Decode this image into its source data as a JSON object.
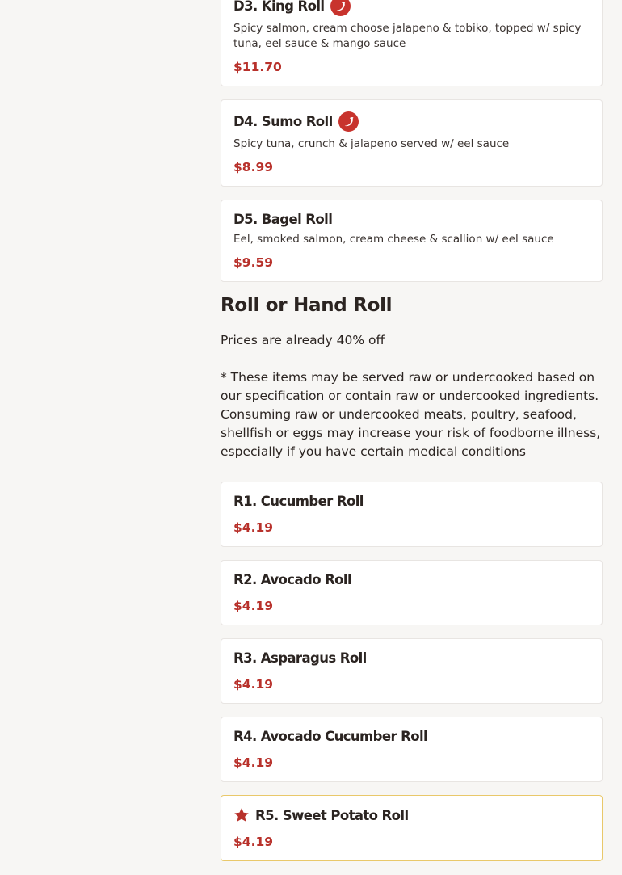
{
  "items_top": [
    {
      "title": "D3. King Roll",
      "spicy": true,
      "description": "Spicy salmon, cream choose jalapeno & tobiko, topped w/ spicy tuna, eel sauce & mango sauce",
      "price": "$11.70"
    },
    {
      "title": "D4. Sumo Roll",
      "spicy": true,
      "description": "Spicy tuna, crunch & jalapeno served w/ eel sauce",
      "price": "$8.99"
    },
    {
      "title": "D5. Bagel Roll",
      "spicy": false,
      "description": "Eel, smoked salmon, cream cheese & scallion w/ eel sauce",
      "price": "$9.59"
    }
  ],
  "section": {
    "title": "Roll or Hand Roll",
    "note_line1": "Prices are already 40% off",
    "note_line2": "* These items may be served raw or undercooked based on our specification or contain raw or undercooked ingredients. Consuming raw or undercooked meats, poultry, seafood, shellfish or eggs may increase your risk of foodborne illness, especially if you have certain medical conditions"
  },
  "items_rolls": [
    {
      "title": "R1. Cucumber Roll",
      "price": "$4.19"
    },
    {
      "title": "R2. Avocado Roll",
      "price": "$4.19"
    },
    {
      "title": "R3. Asparagus Roll",
      "price": "$4.19"
    },
    {
      "title": "R4. Avocado Cucumber Roll",
      "price": "$4.19"
    },
    {
      "title": "R5. Sweet Potato Roll",
      "price": "$4.19",
      "featured": true
    }
  ],
  "icons": {
    "spicy": "chili-pepper-icon",
    "featured": "star-icon"
  },
  "colors": {
    "accent_price": "#b8312b",
    "spicy_badge": "#c8332d",
    "featured_border": "#e9c86a"
  }
}
